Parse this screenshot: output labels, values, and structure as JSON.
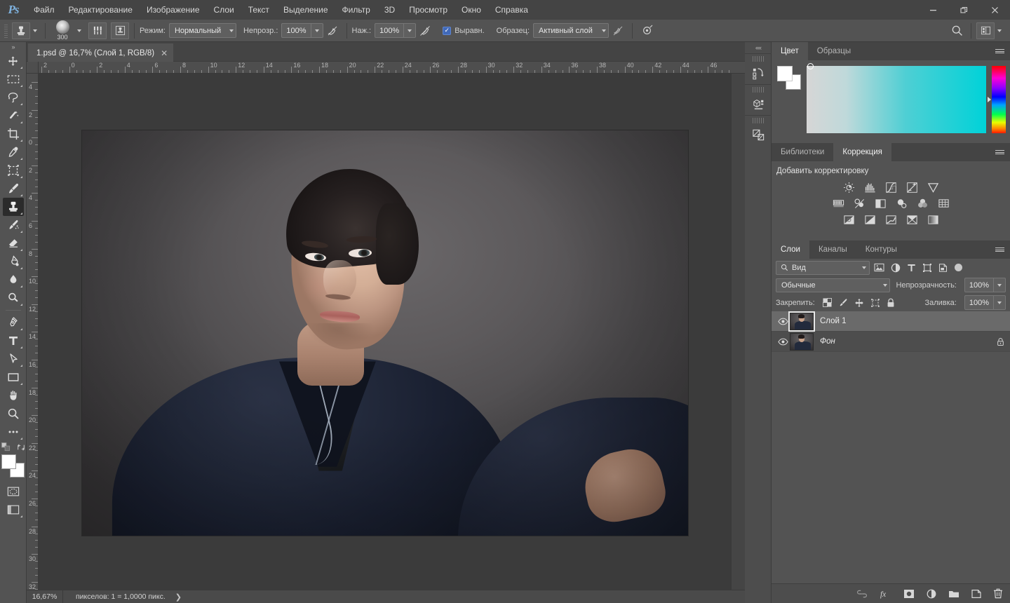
{
  "app": {
    "logo": "Ps",
    "menus": [
      "Файл",
      "Редактирование",
      "Изображение",
      "Слои",
      "Текст",
      "Выделение",
      "Фильтр",
      "3D",
      "Просмотр",
      "Окно",
      "Справка"
    ],
    "window_buttons": [
      {
        "name": "minimize",
        "glyph": "—"
      },
      {
        "name": "restore",
        "glyph": "❐"
      },
      {
        "name": "close",
        "glyph": "✕"
      }
    ]
  },
  "options_bar": {
    "tool_icon": "clone-stamp-icon",
    "brush_size": "300",
    "mode_label": "Режим:",
    "mode_value": "Нормальный",
    "opacity_label": "Непрозр.:",
    "opacity_value": "100%",
    "pressure_label": "Нажа.:",
    "pressure_value": "100%",
    "nazh_label": "Наж.:",
    "aligned_label": "Выравн.",
    "aligned_checked": true,
    "sample_label": "Образец:",
    "sample_value": "Активный слой"
  },
  "toolbar": {
    "collapse": "»",
    "tools": [
      {
        "name": "move-tool",
        "label": "Перемещение"
      },
      {
        "name": "rectangular-marquee-tool",
        "label": "Прямоугольная область"
      },
      {
        "name": "lasso-tool",
        "label": "Лассо"
      },
      {
        "name": "magic-wand-tool",
        "label": "Волшебная палочка"
      },
      {
        "name": "crop-tool",
        "label": "Рамка"
      },
      {
        "name": "eyedropper-tool",
        "label": "Пипетка"
      },
      {
        "name": "frame-tool",
        "label": "Рамка кадра"
      },
      {
        "name": "brush-tool",
        "label": "Кисть"
      },
      {
        "name": "clone-stamp-tool",
        "label": "Штамп",
        "active": true
      },
      {
        "name": "history-brush-tool",
        "label": "Архивная кисть"
      },
      {
        "name": "eraser-tool",
        "label": "Ластик"
      },
      {
        "name": "gradient-tool",
        "label": "Градиент"
      },
      {
        "name": "blur-tool",
        "label": "Размытие"
      },
      {
        "name": "dodge-tool",
        "label": "Осветлитель"
      },
      {
        "name": "pen-tool",
        "label": "Перо"
      },
      {
        "name": "type-tool",
        "label": "Текст"
      },
      {
        "name": "path-selection-tool",
        "label": "Выделение контура"
      },
      {
        "name": "rectangle-tool",
        "label": "Прямоугольник"
      },
      {
        "name": "hand-tool",
        "label": "Рука"
      },
      {
        "name": "zoom-tool",
        "label": "Масштаб"
      },
      {
        "name": "more-tools",
        "label": "Дополнительно"
      }
    ],
    "foreground_color": "#ffffff",
    "background_color": "#ffffff"
  },
  "document": {
    "tab_title": "1.psd @ 16,7% (Слой 1, RGB/8)",
    "close_glyph": "✕",
    "ruler_h_labels": [
      "2",
      "0",
      "2",
      "4",
      "6",
      "8",
      "10",
      "12",
      "14",
      "16",
      "18",
      "20",
      "22",
      "24",
      "26",
      "28",
      "30",
      "32",
      "34",
      "36",
      "38",
      "40",
      "42",
      "44",
      "46"
    ],
    "ruler_v_labels": [
      "4",
      "2",
      "0",
      "2",
      "4",
      "6",
      "8",
      "10",
      "12",
      "14",
      "16",
      "18",
      "20",
      "22",
      "24",
      "26",
      "28",
      "30",
      "32"
    ]
  },
  "status_bar": {
    "zoom": "16,67%",
    "info": "пикселов: 1 = 1,0000 пикс.",
    "arrow": "❯"
  },
  "dock_strip": {
    "collapse": "««",
    "items": [
      {
        "name": "history-panel-icon"
      },
      {
        "name": "properties-panel-icon"
      },
      {
        "name": "layer-comps-panel-icon"
      }
    ]
  },
  "color_panel": {
    "tabs": [
      {
        "label": "Цвет",
        "active": true
      },
      {
        "label": "Образцы",
        "active": false
      }
    ],
    "foreground": "#ffffff",
    "background": "#ffffff",
    "menu_icon": "panel-menu-icon"
  },
  "adjustments_panel": {
    "tabs": [
      {
        "label": "Библиотеки",
        "active": false
      },
      {
        "label": "Коррекция",
        "active": true
      }
    ],
    "title": "Добавить корректировку",
    "row1": [
      "brightness-contrast-icon",
      "levels-icon",
      "curves-icon",
      "exposure-icon",
      "vibrance-icon"
    ],
    "row2": [
      "hue-saturation-icon",
      "color-balance-icon",
      "black-white-icon",
      "photo-filter-icon",
      "channel-mixer-icon",
      "color-lookup-icon"
    ],
    "row3": [
      "invert-icon",
      "posterize-icon",
      "threshold-icon",
      "gradient-map-icon",
      "selective-color-icon"
    ]
  },
  "layers_panel": {
    "tabs": [
      {
        "label": "Слои",
        "active": true
      },
      {
        "label": "Каналы",
        "active": false
      },
      {
        "label": "Контуры",
        "active": false
      }
    ],
    "filter_label": "Вид",
    "filter_icons": [
      "pixel-filter-icon",
      "adjustment-filter-icon",
      "type-filter-icon",
      "shape-filter-icon",
      "smart-object-filter-icon"
    ],
    "blend_mode": "Обычные",
    "opacity_label": "Непрозрачность:",
    "opacity_value": "100%",
    "lock_label": "Закрепить:",
    "lock_icons": [
      "lock-transparency-icon",
      "lock-image-icon",
      "lock-position-icon",
      "lock-artboard-icon",
      "lock-all-icon"
    ],
    "fill_label": "Заливка:",
    "fill_value": "100%",
    "layers": [
      {
        "name": "Слой 1",
        "visible": true,
        "selected": true,
        "locked": false,
        "italic": false
      },
      {
        "name": "Фон",
        "visible": true,
        "selected": false,
        "locked": true,
        "italic": true
      }
    ],
    "footer_icons": [
      "link-layers-icon",
      "layer-style-icon",
      "layer-mask-icon",
      "new-adjustment-layer-icon",
      "new-group-icon",
      "new-layer-icon",
      "delete-layer-icon"
    ]
  },
  "canvas": {
    "image_description": "portrait-photo",
    "zoom_percent": "16,67%"
  }
}
